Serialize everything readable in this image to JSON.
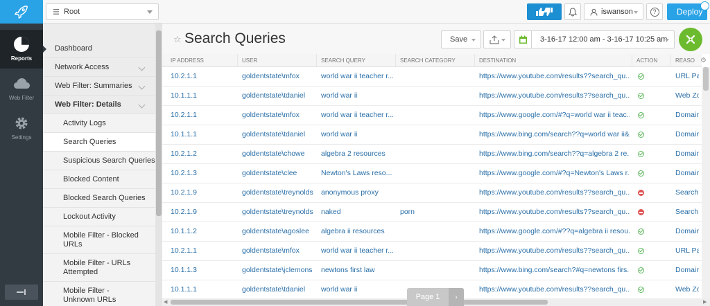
{
  "colors": {
    "accent": "#29a3e6",
    "rail": "#333b42",
    "allow": "#5cb85c",
    "block": "#e05353",
    "fab": "#6cbb2e"
  },
  "rail": {
    "items": [
      {
        "label": "Reports",
        "icon": "pie-chart-icon",
        "active": true
      },
      {
        "label": "Web Filter",
        "icon": "cloud-icon",
        "active": false
      },
      {
        "label": "Settings",
        "icon": "gear-icon",
        "active": false
      }
    ]
  },
  "topbar": {
    "root_label": "Root",
    "user": "iswanson",
    "help": "?",
    "deploy": "Deploy"
  },
  "menu": {
    "items": [
      {
        "label": "Dashboard",
        "kind": "top"
      },
      {
        "label": "Network Access",
        "kind": "top"
      },
      {
        "label": "Web Filter: Summaries",
        "kind": "top"
      },
      {
        "label": "Web Filter: Details",
        "kind": "top"
      },
      {
        "label": "Activity Logs",
        "kind": "sub"
      },
      {
        "label": "Search Queries",
        "kind": "sub"
      },
      {
        "label": "Suspicious Search Queries",
        "kind": "sub"
      },
      {
        "label": "Blocked Content",
        "kind": "sub"
      },
      {
        "label": "Blocked Search Queries",
        "kind": "sub"
      },
      {
        "label": "Lockout Activity",
        "kind": "sub"
      },
      {
        "label": "Mobile Filter - Blocked URLs",
        "kind": "sub"
      },
      {
        "label": "Mobile Filter - URLs Attempted",
        "kind": "sub"
      },
      {
        "label": "Mobile Filter - Unknown URLs",
        "kind": "sub"
      }
    ]
  },
  "page": {
    "title": "Search Queries",
    "save": "Save",
    "date_range": "3-16-17 12:00 am - 3-16-17 10:25 am"
  },
  "table": {
    "columns": [
      "IP ADDRESS",
      "USER",
      "SEARCH QUERY",
      "SEARCH CATEGORY",
      "DESTINATION",
      "ACTION",
      "REASO"
    ],
    "rows": [
      {
        "ip": "10.2.1.1",
        "user": "goldentstate\\mfox",
        "query": "world war ii teacher r...",
        "category": "",
        "dest": "https://www.youtube.com/results??search_qu...",
        "action": "allow",
        "reason": "URL Pa"
      },
      {
        "ip": "10.1.1.1",
        "user": "goldentstate\\tdaniel",
        "query": "world war ii",
        "category": "",
        "dest": "https://www.youtube.com/results??search_qu...",
        "action": "allow",
        "reason": "Web Zo"
      },
      {
        "ip": "10.2.1.1",
        "user": "goldentstate\\mfox",
        "query": "world war ii teacher r...",
        "category": "",
        "dest": "https://www.google.com/#?q=world war ii teac...",
        "action": "allow",
        "reason": "Domain"
      },
      {
        "ip": "10.1.1.1",
        "user": "goldentstate\\tdaniel",
        "query": "world war ii",
        "category": "",
        "dest": "https://www.bing.com/search??q=world war ii&...",
        "action": "allow",
        "reason": "Domain"
      },
      {
        "ip": "10.2.1.2",
        "user": "goldentstate\\chowe",
        "query": "algebra 2 resources",
        "category": "",
        "dest": "https://www.bing.com/search??q=algebra 2 re...",
        "action": "allow",
        "reason": "Domain"
      },
      {
        "ip": "10.2.1.3",
        "user": "goldentstate\\clee",
        "query": "Newton's Laws reso...",
        "category": "",
        "dest": "https://www.google.com/#?q=Newton's Laws r...",
        "action": "allow",
        "reason": "Domain"
      },
      {
        "ip": "10.2.1.9",
        "user": "goldentstate\\treynolds",
        "query": "anonymous proxy",
        "category": "",
        "dest": "https://www.youtube.com/results??search_qu...",
        "action": "block",
        "reason": "Search"
      },
      {
        "ip": "10.2.1.9",
        "user": "goldentstate\\treynolds",
        "query": "naked",
        "category": "porn",
        "dest": "https://www.youtube.com/results??search_qu...",
        "action": "block",
        "reason": "Search"
      },
      {
        "ip": "10.1.1.2",
        "user": "goldentstate\\agoslee",
        "query": "algebra ii resources",
        "category": "",
        "dest": "https://www.google.com/#??q=algebra ii resou...",
        "action": "allow",
        "reason": "Domain"
      },
      {
        "ip": "10.2.1.1",
        "user": "goldentstate\\mfox",
        "query": "world war ii teacher r...",
        "category": "",
        "dest": "https://www.youtube.com/results??search_qu...",
        "action": "allow",
        "reason": "URL Pa"
      },
      {
        "ip": "10.1.1.3",
        "user": "goldentstate\\jclemons",
        "query": "newtons first law",
        "category": "",
        "dest": "https://www.bing.com/search?#q=newtons firs...",
        "action": "allow",
        "reason": "Domain"
      },
      {
        "ip": "10.1.1.1",
        "user": "goldentstate\\tdaniel",
        "query": "world war ii",
        "category": "",
        "dest": "https://www.youtube.com/results??search_qu...",
        "action": "allow",
        "reason": "Web Zo"
      }
    ]
  },
  "pager": {
    "label": "Page 1",
    "next": "›"
  }
}
